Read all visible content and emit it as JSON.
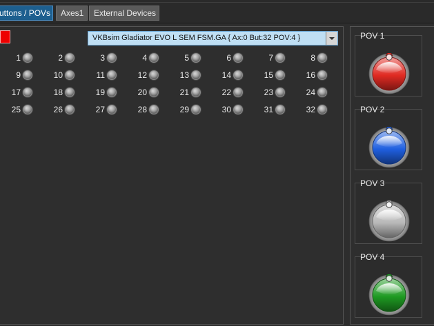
{
  "tabs": [
    {
      "label": "uttons / POVs",
      "active": true
    },
    {
      "label": "Axes1",
      "active": false
    },
    {
      "label": "External Devices",
      "active": false
    }
  ],
  "device": {
    "selected": "VKBsim Gladiator EVO  L SEM FSM.GA  { Ax:0 But:32 POV:4 }"
  },
  "buttons": [
    "1",
    "2",
    "3",
    "4",
    "5",
    "6",
    "7",
    "8",
    "9",
    "10",
    "11",
    "12",
    "13",
    "14",
    "15",
    "16",
    "17",
    "18",
    "19",
    "20",
    "21",
    "22",
    "23",
    "24",
    "25",
    "26",
    "27",
    "28",
    "29",
    "30",
    "31",
    "32"
  ],
  "povs": [
    {
      "label": "POV 1",
      "color": "#e02a22"
    },
    {
      "label": "POV 2",
      "color": "#1f5fe0"
    },
    {
      "label": "POV 3",
      "color": "#b8b8b8"
    },
    {
      "label": "POV 4",
      "color": "#1e9a22"
    }
  ],
  "colors": {
    "active_tab": "#1d5f8f",
    "select_bg": "#bfdff4",
    "indicator": "#ee0000"
  }
}
